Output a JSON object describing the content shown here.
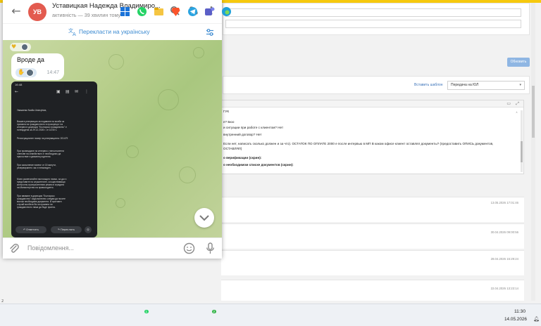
{
  "telegram": {
    "avatar_initials": "УВ",
    "chat_name": "Уставицкая Надежда Владимиро...",
    "chat_status": "активність — 39 хвилин тому",
    "translate_label": "Перекласти на українську",
    "message_text": "Вроде да",
    "message_time": "14:47",
    "composer_placeholder": "Повідомлення...",
    "photo": {
      "status_time": "16:48",
      "lines": [
        "Уважаеми Nadiia Ustavytska,",
        "Вашата резервация за подаване на молба за",
        "промяна на гражданството в прозорецът на",
        "интервю в дирекция \"Българско гражданство\" е",
        "потвърдена за 29.12.2026 г. от 14:50 ч.",
        "Регистрационен номер на резервацията: 201479",
        "При провеждане на интервю с непълнолетни",
        "членове на семейството е необходимо да",
        "присъстват и двамата родители.",
        "При закъснение повече от 15 минути,",
        "резервирането час е невалиден.",
        "Моля разпечатайте настоящото писмо, за да го",
        "представите на служителите, осъществяващи",
        "контролно-пропускателния режим в сградата",
        "на Министерство на правосъдието.",
        "При явяване в дирекция \"Българско",
        "гражданство\" задължително следва да носите",
        "всички необходими документи. В противен",
        "случай молбата Ви за промяна на",
        "гражданството няма да бъде приета."
      ],
      "reply_label": "Ответить",
      "forward_label": "Переслать"
    }
  },
  "crm": {
    "update_button": "Обновить",
    "template_link": "Вставить шаблон",
    "template_select": "Передача на ЮЛ",
    "editor_lines": [
      "ГУК",
      "е? Бюо",
      "и ситуации при работе с клиентом? Нет",
      "внутренний договор? Нет",
      "Если нет, написать сколько должен и за что). ОСТАТОК ПО ОПЛАТЕ 2000 е после интервью в МП В каком офисе клиент оставлял документы? (предоставить ОПИСЬ документов,",
      "ОСТАВЛЯЛ)",
      "о верификации (скрин):",
      "о необходимом списке документов (скрин):"
    ],
    "list_dates": [
      "13.05.2026 17:01:46",
      "30.04.2026 09:00:56",
      "28.04.2026 15:29:24",
      "22.04.2026 13:23:14"
    ],
    "page_number": "2"
  },
  "taskbar": {
    "time": "11:30",
    "date": "14.05.2026",
    "whatsapp_badge": "1",
    "teams_badge": "2"
  },
  "colors": {
    "accent_blue": "#3d8bd1",
    "avatar_red": "#e35b4f",
    "crm_yellow": "#f6c90e"
  }
}
